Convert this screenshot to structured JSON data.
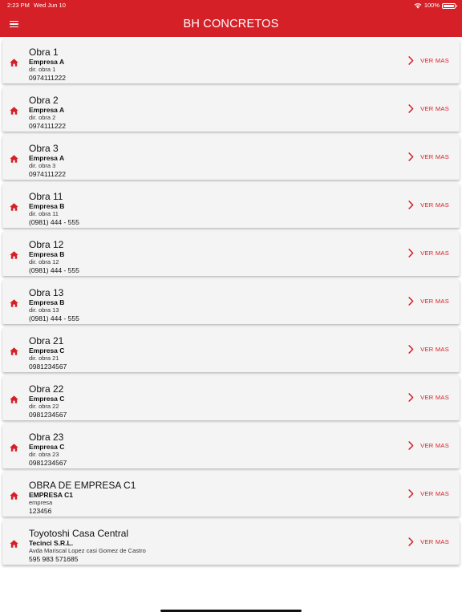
{
  "status_bar": {
    "time": "2:23 PM",
    "date": "Wed Jun 10",
    "battery": "100%",
    "battery_level": 1.0
  },
  "header": {
    "title": "BH CONCRETOS",
    "menu_icon": "hamburger-icon"
  },
  "colors": {
    "brand_red": "#d62027",
    "card_bg": "#f4f4f4"
  },
  "list": {
    "action_label": "VER MAS",
    "row_icon": "home-icon",
    "action_icon": "chevron-right-icon",
    "items": [
      {
        "title": "Obra 1",
        "company": "Empresa A",
        "address": "dir. obra 1",
        "phone": "0974111222"
      },
      {
        "title": "Obra 2",
        "company": "Empresa A",
        "address": "dir. obra 2",
        "phone": "0974111222"
      },
      {
        "title": "Obra 3",
        "company": "Empresa A",
        "address": "dir. obra 3",
        "phone": "0974111222"
      },
      {
        "title": "Obra 11",
        "company": "Empresa B",
        "address": "dir. obra 11",
        "phone": "(0981) 444 - 555"
      },
      {
        "title": "Obra 12",
        "company": "Empresa B",
        "address": "dir. obra 12",
        "phone": "(0981) 444 - 555"
      },
      {
        "title": "Obra 13",
        "company": "Empresa B",
        "address": "dir. obra 13",
        "phone": "(0981) 444 - 555"
      },
      {
        "title": "Obra 21",
        "company": "Empresa C",
        "address": "dir. obra 21",
        "phone": "0981234567"
      },
      {
        "title": "Obra 22",
        "company": "Empresa C",
        "address": "dir. obra 22",
        "phone": "0981234567"
      },
      {
        "title": "Obra 23",
        "company": "Empresa C",
        "address": "dir. obra 23",
        "phone": "0981234567"
      },
      {
        "title": "OBRA DE EMPRESA C1",
        "company": "EMPRESA C1",
        "address": "empresa",
        "phone": "123456"
      },
      {
        "title": "Toyotoshi Casa Central",
        "company": "Tecinci S.R.L.",
        "address": "Avda Mariscal Lopez casi Gomez de Castro",
        "phone": "595 983 571685"
      }
    ]
  }
}
